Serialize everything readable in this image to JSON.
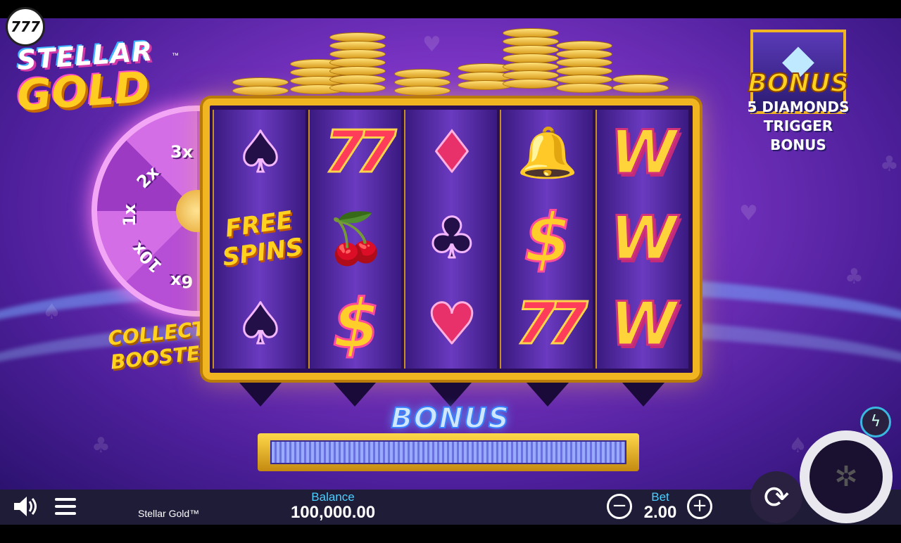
{
  "brand_badge": "777",
  "logo": {
    "line1": "STELLAR",
    "line2": "GOLD",
    "tm": "™"
  },
  "wheel": {
    "segments": [
      "3x",
      "2x",
      "1x",
      "10x",
      "6x"
    ]
  },
  "collect_booster": {
    "line1": "COLLECT",
    "line2": "BOOSTER"
  },
  "bonus_info": {
    "title": "BONUS",
    "line1": "5 DIAMONDS",
    "line2": "TRIGGER BONUS",
    "icon": "diamond-icon"
  },
  "reels": [
    [
      {
        "type": "spade"
      },
      {
        "type": "free-spins",
        "text1": "FREE",
        "text2": "SPINS"
      },
      {
        "type": "spade"
      }
    ],
    [
      {
        "type": "seven",
        "text": "77"
      },
      {
        "type": "cherry"
      },
      {
        "type": "dollar",
        "text": "$"
      }
    ],
    [
      {
        "type": "diamond"
      },
      {
        "type": "club"
      },
      {
        "type": "heart"
      }
    ],
    [
      {
        "type": "bell"
      },
      {
        "type": "dollar",
        "text": "$"
      },
      {
        "type": "seven",
        "text": "77"
      }
    ],
    [
      {
        "type": "wild",
        "text": "W"
      },
      {
        "type": "wild",
        "text": "W"
      },
      {
        "type": "wild",
        "text": "W"
      }
    ]
  ],
  "bonus_bar": {
    "label": "BONUS"
  },
  "bottom_bar": {
    "game_name": "Stellar Gold™",
    "balance_label": "Balance",
    "balance_value": "100,000.00",
    "bet_label": "Bet",
    "bet_value": "2.00"
  },
  "colors": {
    "accent": "#4ad0ff",
    "gold": "#f0b520",
    "background": "#7b34c4"
  }
}
